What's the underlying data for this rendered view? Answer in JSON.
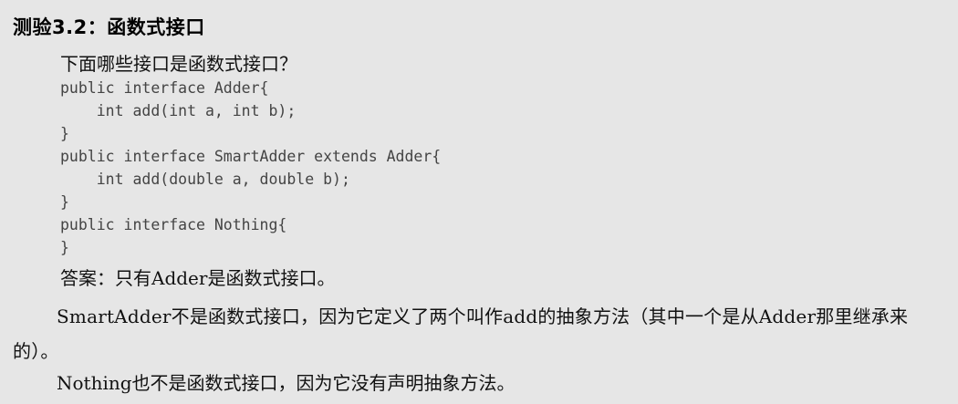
{
  "quiz": {
    "title": "测验3.2：函数式接口",
    "question": "下面哪些接口是函数式接口？",
    "code_lines": [
      "public interface Adder{",
      "    int add(int a, int b);",
      "}",
      "public interface SmartAdder extends Adder{",
      "    int add(double a, double b);",
      "}",
      "public interface Nothing{",
      "}"
    ],
    "answer": "答案：只有Adder是函数式接口。",
    "explanation_1": "SmartAdder不是函数式接口，因为它定义了两个叫作add的抽象方法（其中一个是从Adder那里继承来的）。",
    "explanation_2": "Nothing也不是函数式接口，因为它没有声明抽象方法。"
  }
}
